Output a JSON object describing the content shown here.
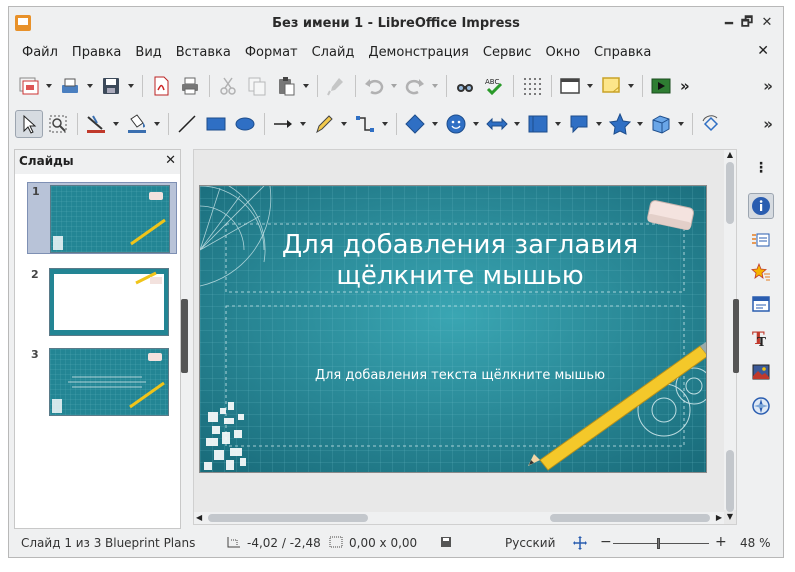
{
  "window": {
    "title": "Без имени 1 - LibreOffice Impress",
    "minimize_glyph": "🗕",
    "restore_glyph": "🗗",
    "close_glyph": "✕"
  },
  "menu": {
    "items": [
      "Файл",
      "Правка",
      "Вид",
      "Вставка",
      "Формат",
      "Слайд",
      "Демонстрация",
      "Сервис",
      "Окно",
      "Справка"
    ],
    "close_glyph": "✕"
  },
  "toolbar_std": {
    "icons": [
      "slide-layout-icon",
      "save-as-print-icon",
      "save-icon",
      "export-pdf-icon",
      "print-icon",
      "cut-icon",
      "copy-icon",
      "paste-icon",
      "clone-formatting-icon",
      "undo-icon",
      "redo-icon",
      "find-replace-icon",
      "spelling-icon",
      "grid-icon",
      "display-views-icon",
      "notes-icon",
      "start-show-icon"
    ],
    "more_glyph": "»"
  },
  "toolbar_draw": {
    "more_glyph": "»"
  },
  "slides_panel": {
    "title": "Слайды",
    "close_glyph": "✕",
    "thumbs": [
      {
        "num": "1"
      },
      {
        "num": "2"
      },
      {
        "num": "3"
      }
    ]
  },
  "slide": {
    "title": "Для добавления заглавия щёлкните мышью",
    "subtitle": "Для добавления текста щёлкните мышью"
  },
  "sidebar": {
    "menu_glyph": "⋮",
    "icons": [
      "properties-icon",
      "slide-transition-icon",
      "animation-icon",
      "master-slides-icon",
      "styles-icon",
      "gallery-icon",
      "navigator-icon"
    ]
  },
  "status": {
    "slide": "Слайд 1 из 3",
    "master": "Blueprint Plans",
    "position": "-4,02 / -2,48",
    "size": "0,00 x 0,00",
    "language": "Русский",
    "zoom": "48 %",
    "zoom_minus": "−",
    "zoom_plus": "+"
  },
  "colors": {
    "blueprint": "#2b8e9c",
    "accent": "#3a6fb0"
  }
}
